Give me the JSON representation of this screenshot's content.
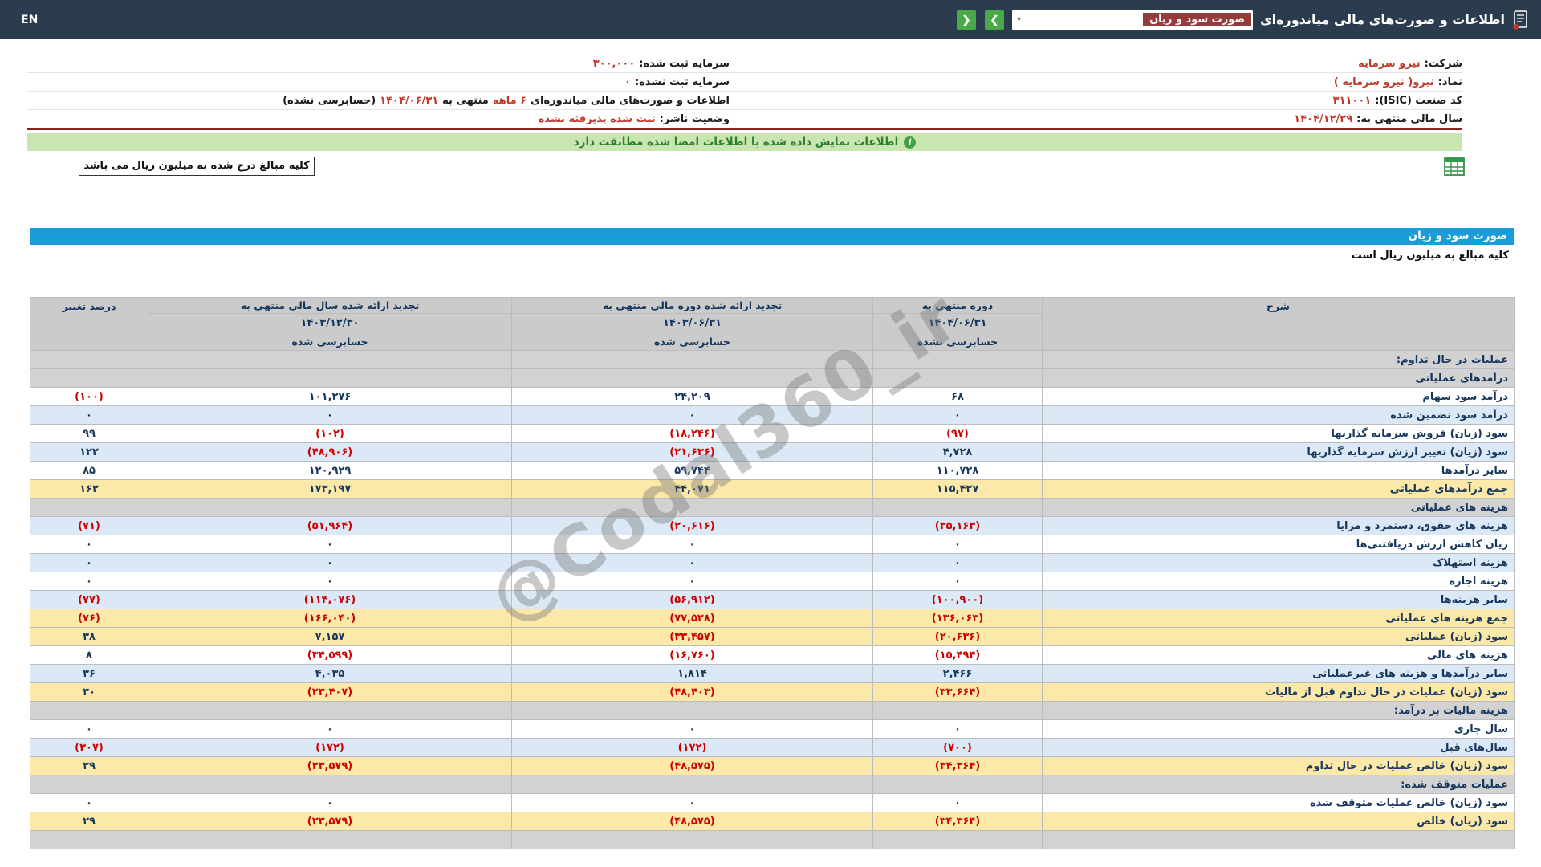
{
  "topbar": {
    "en_label": "EN",
    "title": "اطلاعات و صورت‌های مالی میاندوره‌ای",
    "report_dropdown_value": "صورت سود و زیان",
    "next_arrow": "❯",
    "prev_arrow": "❮"
  },
  "company_info": {
    "rows": [
      {
        "right_label": "شرکت:",
        "right_value": "نیرو سرمایه",
        "right_link": true,
        "left_label": "سرمایه ثبت شده:",
        "left_value": "۳۰۰,۰۰۰"
      },
      {
        "right_label": "نماد:",
        "right_value": "نیرو( نیرو سرمایه )",
        "right_link": true,
        "left_label": "سرمایه ثبت نشده:",
        "left_value": "۰"
      },
      {
        "right_label": "کد صنعت (ISIC):",
        "right_value": "۳۱۱۰۰۱",
        "left_segments": [
          {
            "text": "اطلاعات و صورت‌های مالی میاندوره‌ای ",
            "red": false
          },
          {
            "text": "۶ ماهه",
            "red": true
          },
          {
            "text": " منتهی به ",
            "red": false
          },
          {
            "text": "۱۴۰۴/۰۶/۳۱",
            "red": true
          },
          {
            "text": "(حسابرسی نشده)",
            "red": false
          }
        ]
      },
      {
        "right_label": "سال مالی منتهی به:",
        "right_value": "۱۴۰۴/۱۲/۲۹",
        "left_label": "وضعیت ناشر:",
        "left_value": "ثبت شده پذیرفته نشده"
      }
    ]
  },
  "banner": {
    "text": "اطلاعات نمایش داده شده با اطلاعات امضا شده مطابقت دارد",
    "icon": "info-icon"
  },
  "unit_box": {
    "text": "کلیه مبالغ درج شده به میلیون ریال می باشد"
  },
  "statement": {
    "title": "صورت سود و زیان",
    "unit_note": "کلیه مبالغ به میلیون ریال است",
    "watermark": "@Codal360_ir",
    "header": {
      "desc": "شرح",
      "change": "درصد تغییر",
      "cols": [
        {
          "title": "دوره منتهی به",
          "date": "۱۴۰۴/۰۶/۳۱",
          "audit": "حسابرسی نشده"
        },
        {
          "title": "تجدید ارائه شده دوره مالی منتهی به",
          "date": "۱۴۰۳/۰۶/۳۱",
          "audit": "حسابرسی شده"
        },
        {
          "title": "تجدید ارائه شده سال مالی منتهی به",
          "date": "۱۴۰۳/۱۲/۳۰",
          "audit": "حسابرسی شده"
        }
      ]
    },
    "rows": [
      {
        "type": "section",
        "desc": "عملیات در حال تداوم:"
      },
      {
        "type": "section",
        "desc": "درآمدهای عملیاتی"
      },
      {
        "type": "data",
        "style": "white",
        "desc": "درآمد سود سهام",
        "current": "۶۸",
        "prev": "۲۴,۲۰۹",
        "year": "۱۰۱,۲۷۶",
        "change": "(۱۰۰)"
      },
      {
        "type": "data",
        "style": "blue",
        "desc": "درآمد سود تضمین شده",
        "current": "۰",
        "prev": "۰",
        "year": "۰",
        "change": "۰"
      },
      {
        "type": "data",
        "style": "white",
        "desc": "سود (زیان) فروش سرمایه گذاریها",
        "current": "(۹۷)",
        "prev": "(۱۸,۲۴۶)",
        "year": "(۱۰۲)",
        "change": "۹۹"
      },
      {
        "type": "data",
        "style": "blue",
        "desc": "سود (زیان) تغییر ارزش سرمایه گذاریها",
        "current": "۴,۷۲۸",
        "prev": "(۲۱,۶۳۶)",
        "year": "(۴۸,۹۰۶)",
        "change": "۱۲۲"
      },
      {
        "type": "data",
        "style": "white",
        "desc": "سایر درآمدها",
        "current": "۱۱۰,۷۲۸",
        "prev": "۵۹,۷۴۴",
        "year": "۱۲۰,۹۲۹",
        "change": "۸۵"
      },
      {
        "type": "data",
        "style": "yellow",
        "desc": "جمع درآمدهای عملیاتی",
        "current": "۱۱۵,۴۲۷",
        "prev": "۴۴,۰۷۱",
        "year": "۱۷۳,۱۹۷",
        "change": "۱۶۲"
      },
      {
        "type": "section",
        "desc": "هزینه های عملیاتی"
      },
      {
        "type": "data",
        "style": "blue",
        "desc": "هزینه های حقوق، دستمزد و مزایا",
        "current": "(۳۵,۱۶۳)",
        "prev": "(۲۰,۶۱۶)",
        "year": "(۵۱,۹۶۴)",
        "change": "(۷۱)"
      },
      {
        "type": "data",
        "style": "white",
        "desc": "زیان کاهش ارزش دریافتنی‌ها",
        "current": "۰",
        "prev": "۰",
        "year": "۰",
        "change": "۰"
      },
      {
        "type": "data",
        "style": "blue",
        "desc": "هزینه استهلاک",
        "current": "۰",
        "prev": "۰",
        "year": "۰",
        "change": "۰"
      },
      {
        "type": "data",
        "style": "white",
        "desc": "هزینه اجاره",
        "current": "۰",
        "prev": "۰",
        "year": "۰",
        "change": "۰"
      },
      {
        "type": "data",
        "style": "blue",
        "desc": "سایر هزینه‌ها",
        "current": "(۱۰۰,۹۰۰)",
        "prev": "(۵۶,۹۱۲)",
        "year": "(۱۱۴,۰۷۶)",
        "change": "(۷۷)"
      },
      {
        "type": "data",
        "style": "yellow",
        "desc": "جمع هزینه های عملیاتی",
        "current": "(۱۳۶,۰۶۳)",
        "prev": "(۷۷,۵۲۸)",
        "year": "(۱۶۶,۰۴۰)",
        "change": "(۷۶)"
      },
      {
        "type": "data",
        "style": "yellow",
        "desc": "سود (زیان) عملیاتی",
        "current": "(۲۰,۶۳۶)",
        "prev": "(۳۳,۴۵۷)",
        "year": "۷,۱۵۷",
        "change": "۳۸"
      },
      {
        "type": "data",
        "style": "white",
        "desc": "هزینه های مالی",
        "current": "(۱۵,۴۹۴)",
        "prev": "(۱۶,۷۶۰)",
        "year": "(۳۴,۵۹۹)",
        "change": "۸"
      },
      {
        "type": "data",
        "style": "blue",
        "desc": "سایر درآمدها و هزینه های غیرعملیاتی",
        "current": "۲,۴۶۶",
        "prev": "۱,۸۱۴",
        "year": "۴,۰۳۵",
        "change": "۳۶"
      },
      {
        "type": "data",
        "style": "yellow",
        "desc": "سود (زیان) عملیات در حال تداوم قبل از مالیات",
        "current": "(۳۳,۶۶۴)",
        "prev": "(۴۸,۴۰۳)",
        "year": "(۲۳,۴۰۷)",
        "change": "۳۰"
      },
      {
        "type": "section",
        "desc": "هزینه مالیات بر درآمد:"
      },
      {
        "type": "data",
        "style": "white",
        "desc": "سال جاری",
        "current": "۰",
        "prev": "۰",
        "year": "۰",
        "change": "۰"
      },
      {
        "type": "data",
        "style": "blue",
        "desc": "سال‌های قبل",
        "current": "(۷۰۰)",
        "prev": "(۱۷۲)",
        "year": "(۱۷۲)",
        "change": "(۳۰۷)"
      },
      {
        "type": "data",
        "style": "yellow",
        "desc": "سود (زیان) خالص عملیات در حال تداوم",
        "current": "(۳۴,۳۶۴)",
        "prev": "(۴۸,۵۷۵)",
        "year": "(۲۳,۵۷۹)",
        "change": "۲۹"
      },
      {
        "type": "section",
        "desc": "عملیات متوقف شده:"
      },
      {
        "type": "data",
        "style": "white",
        "desc": "سود (زیان) خالص عملیات متوقف شده",
        "current": "۰",
        "prev": "۰",
        "year": "۰",
        "change": "۰"
      },
      {
        "type": "data",
        "style": "yellow",
        "desc": "سود (زیان) خالص",
        "current": "(۳۴,۳۶۴)",
        "prev": "(۴۸,۵۷۵)",
        "year": "(۲۳,۵۷۹)",
        "change": "۲۹"
      },
      {
        "type": "section",
        "desc": ""
      }
    ]
  },
  "colors": {
    "topbar_bg": "#2b3c4e",
    "accent_blue": "#1a9cd8",
    "nav_green": "#4aaa4a",
    "banner_green_bg": "#c9e6b0",
    "negative_red": "#cc0000",
    "positive_navy": "#17375d",
    "total_row_yellow": "#fce8a8",
    "alt_row_blue": "#dbe8f6",
    "section_gray": "#d2d2d2",
    "value_red": "#c0392b",
    "separator_maroon": "#8b2020"
  }
}
